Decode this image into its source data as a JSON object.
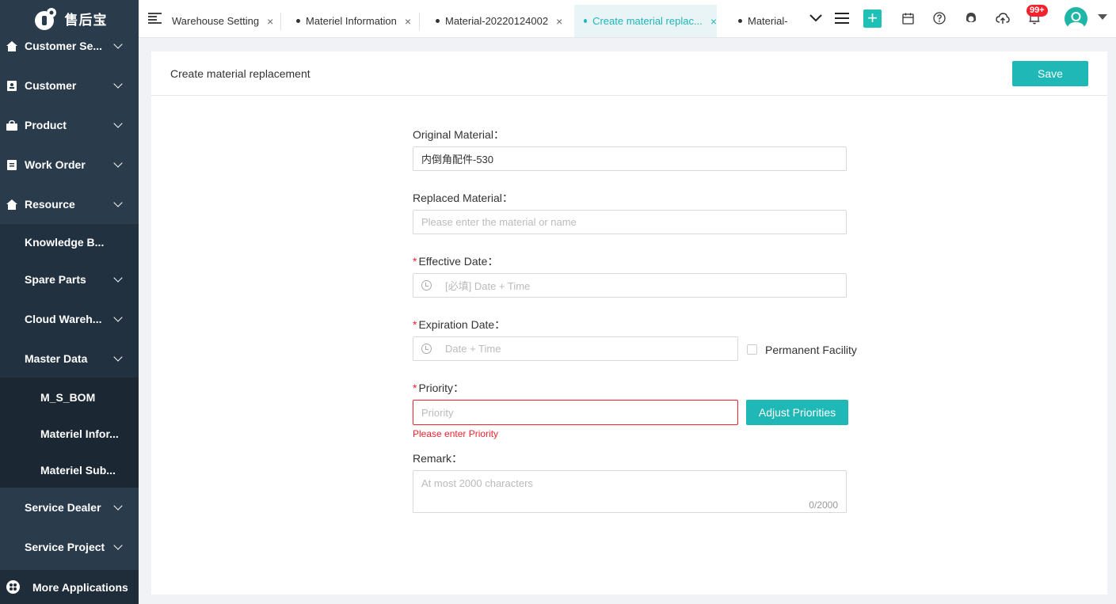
{
  "app": {
    "logo_text": "售后宝"
  },
  "sidebar": {
    "items": [
      {
        "label": "Customer Se..."
      },
      {
        "label": "Customer"
      },
      {
        "label": "Product"
      },
      {
        "label": "Work Order"
      },
      {
        "label": "Resource"
      }
    ],
    "sub_items": [
      {
        "label": "Knowledge B..."
      },
      {
        "label": "Spare Parts"
      },
      {
        "label": "Cloud Wareh..."
      },
      {
        "label": "Master Data"
      }
    ],
    "master_data_items": [
      {
        "label": "M_S_BOM"
      },
      {
        "label": "Materiel Infor..."
      },
      {
        "label": "Materiel Sub..."
      }
    ],
    "bottom_items": [
      {
        "label": "Service Dealer"
      },
      {
        "label": "Service Project"
      }
    ],
    "more_apps": "More Applications"
  },
  "tabs": [
    {
      "label": "Warehouse Setting",
      "close": "×"
    },
    {
      "label": "Materiel Information",
      "close": "×"
    },
    {
      "label": "Material-20220124002",
      "close": "×"
    },
    {
      "label": "Create material replac...",
      "close": "×"
    },
    {
      "label": "Material-"
    }
  ],
  "topbar": {
    "notification_badge": "99+"
  },
  "page": {
    "title": "Create material replacement",
    "save_label": "Save"
  },
  "form": {
    "original_material": {
      "label": "Original Material：",
      "value": "内倒角配件-530"
    },
    "replaced_material": {
      "label": "Replaced Material：",
      "placeholder": "Please enter the material or name"
    },
    "effective_date": {
      "required": "*",
      "label": "Effective Date：",
      "placeholder": "[必填] Date + Time"
    },
    "expiration_date": {
      "required": "*",
      "label": "Expiration Date：",
      "placeholder": "Date + Time"
    },
    "permanent_facility": {
      "label": "Permanent Facility",
      "checked": false
    },
    "priority": {
      "required": "*",
      "label": "Priority：",
      "placeholder": "Priority",
      "error": "Please enter Priority",
      "adjust_label": "Adjust Priorities"
    },
    "remark": {
      "label": "Remark：",
      "placeholder": "At most 2000 characters",
      "count": "0/2000"
    }
  },
  "colors": {
    "accent": "#1fb8b6",
    "sidebar": "#2a3b4c",
    "error": "#f5222d"
  }
}
